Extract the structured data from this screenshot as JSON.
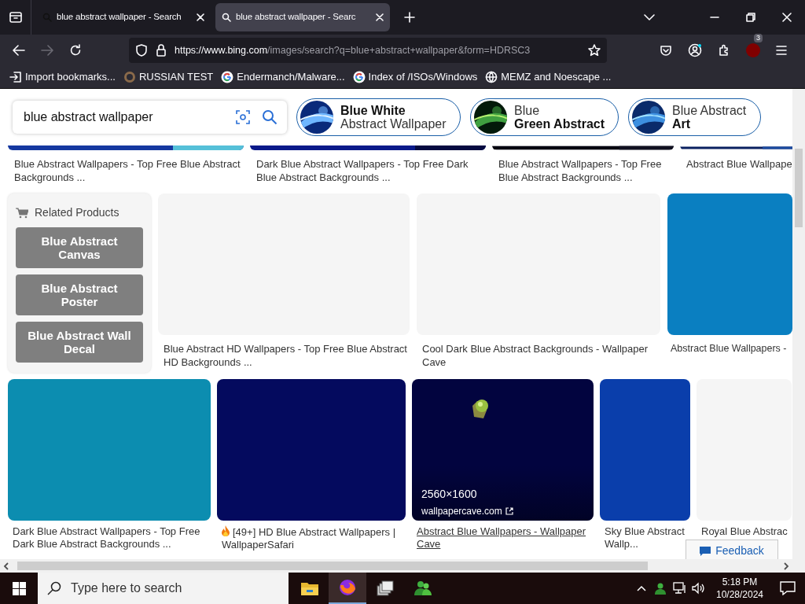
{
  "tabs": [
    {
      "title": "blue abstract wallpaper - Search",
      "selected": false
    },
    {
      "title": "blue abstract wallpaper - Searc",
      "selected": true
    }
  ],
  "address_bar": {
    "url_host": "https://www.bing.com",
    "url_path": "/images/search?q=blue+abstract+wallpaper&form=HDRSC3"
  },
  "extension_badge": "3",
  "bookmarks": [
    {
      "label": "Import bookmarks...",
      "kind": "import"
    },
    {
      "label": "RUSSIAN TEST",
      "kind": "ring"
    },
    {
      "label": "Endermanch/Malware...",
      "kind": "google"
    },
    {
      "label": "Index of /ISOs/Windows",
      "kind": "google"
    },
    {
      "label": "MEMZ and Noescape ...",
      "kind": "globe"
    }
  ],
  "search": {
    "value": "blue abstract wallpaper"
  },
  "suggestions": [
    {
      "line_1": "Blue White",
      "line_2": "Abstract Wallpaper",
      "kind": "bold-top"
    },
    {
      "line_1": "Blue",
      "line_2": "Green Abstract",
      "kind": "bold-bottom"
    },
    {
      "line_1": "Blue Abstract",
      "line_2": "Art",
      "kind": "bold-bottom"
    }
  ],
  "row_1_captions": [
    "Blue Abstract Wallpapers - Top Free Blue Abstract Backgrounds ...",
    "Dark Blue Abstract Wallpapers - Top Free Dark Blue Abstract Backgrounds ...",
    "Blue Abstract Wallpapers - Top Free Blue Abstract Backgrounds ...",
    "Abstract Blue Wallpape"
  ],
  "related_products": {
    "title": "Related Products",
    "items": [
      "Blue Abstract Canvas",
      "Blue Abstract Poster",
      "Blue Abstract Wall Decal"
    ]
  },
  "row_2_captions": [
    "Blue Abstract HD Wallpapers - Top Free Blue Abstract HD Backgrounds ...",
    "Cool Dark Blue Abstract Backgrounds - Wallpaper Cave",
    "Abstract Blue Wallpapers -"
  ],
  "row_3": [
    {
      "caption": "Dark Blue Abstract Wallpapers - Top Free Dark Blue Abstract Backgrounds ...",
      "kind": "plain",
      "hovered": false
    },
    {
      "caption": "[49+] HD Blue Abstract Wallpapers | WallpaperSafari",
      "kind": "fire",
      "hovered": false
    },
    {
      "caption": "Abstract Blue Wallpapers - Wallpaper Cave",
      "kind": "plain",
      "hovered": true,
      "size": "2560×1600",
      "source": "wallpapercave.com"
    },
    {
      "caption": "Sky Blue Abstract Wallp...",
      "kind": "plain",
      "hovered": false
    },
    {
      "caption": "Royal Blue Abstrac",
      "kind": "plain",
      "hovered": false
    }
  ],
  "feedback": "Feedback",
  "taskbar": {
    "search_placeholder": "Type here to search",
    "time": "5:18 PM",
    "date": "10/28/2024"
  }
}
